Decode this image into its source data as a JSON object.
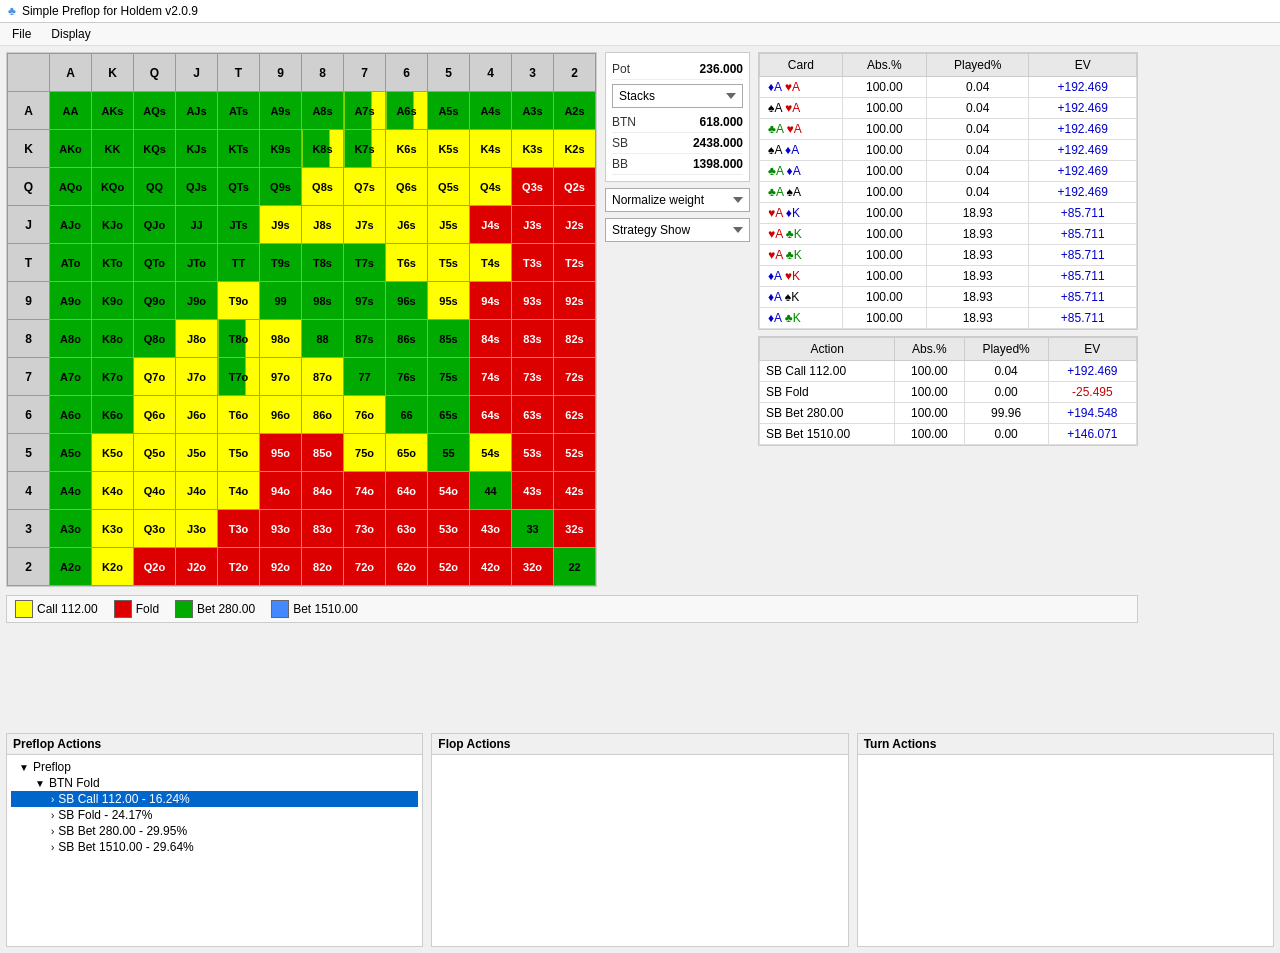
{
  "app": {
    "title": "Simple Preflop for Holdem v2.0.9",
    "icon": "♣"
  },
  "menu": {
    "items": [
      "File",
      "Display"
    ]
  },
  "grid": {
    "headers": [
      "A",
      "K",
      "Q",
      "J",
      "T",
      "9",
      "8",
      "7",
      "6",
      "5",
      "4",
      "3",
      "2"
    ],
    "cells": [
      [
        "AA",
        "AKs",
        "AQs",
        "AJs",
        "ATs",
        "A9s",
        "A8s",
        "A7s",
        "A6s",
        "A5s",
        "A4s",
        "A3s",
        "A2s"
      ],
      [
        "AKo",
        "KK",
        "KQs",
        "KJs",
        "KTs",
        "K9s",
        "K8s",
        "K7s",
        "K6s",
        "K5s",
        "K4s",
        "K3s",
        "K2s"
      ],
      [
        "AQo",
        "KQo",
        "QQ",
        "QJs",
        "QTs",
        "Q9s",
        "Q8s",
        "Q7s",
        "Q6s",
        "Q5s",
        "Q4s",
        "Q3s",
        "Q2s"
      ],
      [
        "AJo",
        "KJo",
        "QJo",
        "JJ",
        "JTs",
        "J9s",
        "J8s",
        "J7s",
        "J6s",
        "J5s",
        "J4s",
        "J3s",
        "J2s"
      ],
      [
        "ATo",
        "KTo",
        "QTo",
        "JTo",
        "TT",
        "T9s",
        "T8s",
        "T7s",
        "T6s",
        "T5s",
        "T4s",
        "T3s",
        "T2s"
      ],
      [
        "A9o",
        "K9o",
        "Q9o",
        "J9o",
        "T9o",
        "99",
        "98s",
        "97s",
        "96s",
        "95s",
        "94s",
        "93s",
        "92s"
      ],
      [
        "A8o",
        "K8o",
        "Q8o",
        "J8o",
        "T8o",
        "98o",
        "88",
        "87s",
        "86s",
        "85s",
        "84s",
        "83s",
        "82s"
      ],
      [
        "A7o",
        "K7o",
        "Q7o",
        "J7o",
        "T7o",
        "97o",
        "87o",
        "77",
        "76s",
        "75s",
        "74s",
        "73s",
        "72s"
      ],
      [
        "A6o",
        "K6o",
        "Q6o",
        "J6o",
        "T6o",
        "96o",
        "86o",
        "76o",
        "66",
        "65s",
        "64s",
        "63s",
        "62s"
      ],
      [
        "A5o",
        "K5o",
        "Q5o",
        "J5o",
        "T5o",
        "95o",
        "85o",
        "75o",
        "65o",
        "55",
        "54s",
        "53s",
        "52s"
      ],
      [
        "A4o",
        "K4o",
        "Q4o",
        "J4o",
        "T4o",
        "94o",
        "84o",
        "74o",
        "64o",
        "54o",
        "44",
        "43s",
        "42s"
      ],
      [
        "A3o",
        "K3o",
        "Q3o",
        "J3o",
        "T3o",
        "93o",
        "83o",
        "73o",
        "63o",
        "53o",
        "43o",
        "33",
        "32s"
      ],
      [
        "A2o",
        "K2o",
        "Q2o",
        "J2o",
        "T2o",
        "92o",
        "82o",
        "72o",
        "62o",
        "52o",
        "42o",
        "32o",
        "22"
      ]
    ],
    "colors": [
      [
        "green",
        "green",
        "green",
        "green",
        "green",
        "green",
        "green",
        "mix-gy",
        "mix-gy",
        "green",
        "green",
        "green",
        "green"
      ],
      [
        "green",
        "green",
        "green",
        "green",
        "green",
        "green",
        "mix-gy",
        "mix-gy",
        "yellow",
        "yellow",
        "yellow",
        "yellow",
        "yellow"
      ],
      [
        "green",
        "green",
        "green",
        "green",
        "green",
        "green",
        "yellow",
        "yellow",
        "yellow",
        "yellow",
        "yellow",
        "red",
        "red"
      ],
      [
        "green",
        "green",
        "green",
        "green",
        "green",
        "yellow",
        "yellow",
        "yellow",
        "yellow",
        "yellow",
        "red",
        "red",
        "red"
      ],
      [
        "green",
        "green",
        "green",
        "green",
        "green",
        "green",
        "green",
        "green",
        "yellow",
        "yellow",
        "yellow",
        "red",
        "red"
      ],
      [
        "green",
        "green",
        "green",
        "green",
        "yellow",
        "green",
        "green",
        "green",
        "green",
        "yellow",
        "red",
        "red",
        "red"
      ],
      [
        "green",
        "green",
        "green",
        "yellow",
        "mix-gy",
        "yellow",
        "green",
        "green",
        "green",
        "green",
        "red",
        "red",
        "red"
      ],
      [
        "green",
        "green",
        "yellow",
        "yellow",
        "mix-gy",
        "yellow",
        "yellow",
        "green",
        "green",
        "green",
        "red",
        "red",
        "red"
      ],
      [
        "green",
        "green",
        "yellow",
        "yellow",
        "yellow",
        "yellow",
        "yellow",
        "yellow",
        "green",
        "green",
        "red",
        "red",
        "red"
      ],
      [
        "green",
        "yellow",
        "yellow",
        "yellow",
        "yellow",
        "red",
        "red",
        "yellow",
        "yellow",
        "green",
        "yellow",
        "red",
        "red"
      ],
      [
        "green",
        "yellow",
        "yellow",
        "yellow",
        "yellow",
        "red",
        "red",
        "red",
        "red",
        "red",
        "green",
        "red",
        "red"
      ],
      [
        "green",
        "yellow",
        "yellow",
        "yellow",
        "red",
        "red",
        "red",
        "red",
        "red",
        "red",
        "red",
        "green",
        "red"
      ],
      [
        "green",
        "yellow",
        "red",
        "red",
        "red",
        "red",
        "red",
        "red",
        "red",
        "red",
        "red",
        "red",
        "green"
      ]
    ]
  },
  "info": {
    "pot_label": "Pot",
    "pot_value": "236.000",
    "stacks_label": "Stacks",
    "btn_label": "BTN",
    "btn_value": "618.000",
    "sb_label": "SB",
    "sb_value": "2438.000",
    "bb_label": "BB",
    "bb_value": "1398.000",
    "normalize_weight_label": "Normalize weight",
    "strategy_show_label": "Strategy Show"
  },
  "card_table": {
    "headers": [
      "Card",
      "Abs.%",
      "Played%",
      "EV"
    ],
    "rows": [
      {
        "card": "♦A ♥A",
        "card_suits": [
          "d",
          "h"
        ],
        "card_ranks": [
          "A",
          "A"
        ],
        "abs": "100.00",
        "played": "0.04",
        "ev": "+192.469",
        "ev_positive": true
      },
      {
        "card": "♠A ♥A",
        "card_suits": [
          "s",
          "h"
        ],
        "card_ranks": [
          "A",
          "A"
        ],
        "abs": "100.00",
        "played": "0.04",
        "ev": "+192.469",
        "ev_positive": true
      },
      {
        "card": "♣A ♥A",
        "card_suits": [
          "c",
          "h"
        ],
        "card_ranks": [
          "A",
          "A"
        ],
        "abs": "100.00",
        "played": "0.04",
        "ev": "+192.469",
        "ev_positive": true
      },
      {
        "card": "♠A ♦A",
        "card_suits": [
          "s",
          "d"
        ],
        "card_ranks": [
          "A",
          "A"
        ],
        "abs": "100.00",
        "played": "0.04",
        "ev": "+192.469",
        "ev_positive": true
      },
      {
        "card": "♣A ♦A",
        "card_suits": [
          "c",
          "d"
        ],
        "card_ranks": [
          "A",
          "A"
        ],
        "abs": "100.00",
        "played": "0.04",
        "ev": "+192.469",
        "ev_positive": true
      },
      {
        "card": "♣A ♠A",
        "card_suits": [
          "c",
          "s"
        ],
        "card_ranks": [
          "A",
          "A"
        ],
        "abs": "100.00",
        "played": "0.04",
        "ev": "+192.469",
        "ev_positive": true
      },
      {
        "card": "♥A ♦K",
        "card_suits": [
          "h",
          "d"
        ],
        "card_ranks": [
          "A",
          "K"
        ],
        "abs": "100.00",
        "played": "18.93",
        "ev": "+85.711",
        "ev_positive": true
      },
      {
        "card": "♥A ♣K",
        "card_suits": [
          "h",
          "c"
        ],
        "card_ranks": [
          "A",
          "K"
        ],
        "abs": "100.00",
        "played": "18.93",
        "ev": "+85.711",
        "ev_positive": true
      },
      {
        "card": "♥A ♣K",
        "card_suits": [
          "h",
          "c"
        ],
        "card_ranks": [
          "A",
          "K"
        ],
        "abs": "100.00",
        "played": "18.93",
        "ev": "+85.711",
        "ev_positive": true
      },
      {
        "card": "♦A ♥K",
        "card_suits": [
          "d",
          "h"
        ],
        "card_ranks": [
          "A",
          "K"
        ],
        "abs": "100.00",
        "played": "18.93",
        "ev": "+85.711",
        "ev_positive": true
      },
      {
        "card": "♦A ♠K",
        "card_suits": [
          "d",
          "s"
        ],
        "card_ranks": [
          "A",
          "K"
        ],
        "abs": "100.00",
        "played": "18.93",
        "ev": "+85.711",
        "ev_positive": true
      },
      {
        "card": "♦A ♣K",
        "card_suits": [
          "d",
          "c"
        ],
        "card_ranks": [
          "A",
          "K"
        ],
        "abs": "100.00",
        "played": "18.93",
        "ev": "+85.711",
        "ev_positive": true
      }
    ]
  },
  "action_table": {
    "headers": [
      "Action",
      "Abs.%",
      "Played%",
      "EV"
    ],
    "rows": [
      {
        "action": "SB Call 112.00",
        "abs": "100.00",
        "played": "0.04",
        "ev": "+192.469",
        "ev_positive": true
      },
      {
        "action": "SB Fold",
        "abs": "100.00",
        "played": "0.00",
        "ev": "-25.495",
        "ev_positive": false
      },
      {
        "action": "SB Bet 280.00",
        "abs": "100.00",
        "played": "99.96",
        "ev": "+194.548",
        "ev_positive": true
      },
      {
        "action": "SB Bet 1510.00",
        "abs": "100.00",
        "played": "0.00",
        "ev": "+146.071",
        "ev_positive": true
      }
    ]
  },
  "legend": {
    "items": [
      {
        "color": "#ffff00",
        "label": "Call 112.00"
      },
      {
        "color": "#dd0000",
        "label": "Fold"
      },
      {
        "color": "#00aa00",
        "label": "Bet 280.00"
      },
      {
        "color": "#4488ff",
        "label": "Bet 1510.00"
      }
    ]
  },
  "preflop_actions": {
    "title": "Preflop Actions",
    "tree": [
      {
        "level": 0,
        "label": "Preflop",
        "expanded": true
      },
      {
        "level": 1,
        "label": "BTN Fold",
        "expanded": true
      },
      {
        "level": 2,
        "label": "SB Call 112.00 - 16.24%",
        "selected": true
      },
      {
        "level": 2,
        "label": "SB Fold - 24.17%",
        "selected": false
      },
      {
        "level": 2,
        "label": "SB Bet 280.00 - 29.95%",
        "selected": false
      },
      {
        "level": 2,
        "label": "SB Bet 1510.00 - 29.64%",
        "selected": false
      }
    ]
  },
  "flop_actions": {
    "title": "Flop Actions"
  },
  "turn_actions": {
    "title": "Turn Actions"
  }
}
